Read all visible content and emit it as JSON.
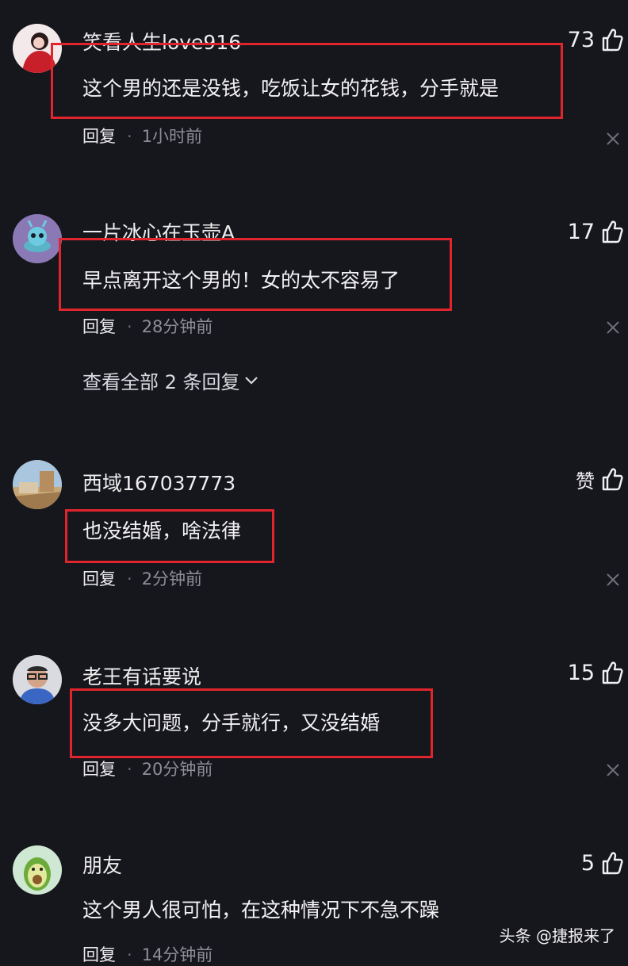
{
  "comments": [
    {
      "username": "笑看人生love916",
      "text": "这个男的还是没钱，吃饭让女的花钱，分手就是",
      "reply_label": "回复",
      "separator": "·",
      "time": "1小时前",
      "likes": "73"
    },
    {
      "username": "一片冰心在玉壶A",
      "text": "早点离开这个男的！女的太不容易了",
      "reply_label": "回复",
      "separator": "·",
      "time": "28分钟前",
      "likes": "17",
      "view_replies": "查看全部 2 条回复"
    },
    {
      "username": "西域167037773",
      "text": "也没结婚，啥法律",
      "reply_label": "回复",
      "separator": "·",
      "time": "2分钟前",
      "likes": "赞"
    },
    {
      "username": "老王有话要说",
      "text": "没多大问题，分手就行，又没结婚",
      "reply_label": "回复",
      "separator": "·",
      "time": "20分钟前",
      "likes": "15"
    },
    {
      "username": "朋友",
      "text": "这个男人很可怕，在这种情况下不急不躁",
      "reply_label": "回复",
      "separator": "·",
      "time": "14分钟前",
      "likes": "5"
    }
  ],
  "watermark": "头条 @捷报来了",
  "colors": {
    "background": "#16161d",
    "highlight_border": "#e1252c",
    "muted_text": "#8e8e99"
  },
  "icons": [
    "thumbs-up-icon",
    "close-icon",
    "chevron-down-icon"
  ]
}
